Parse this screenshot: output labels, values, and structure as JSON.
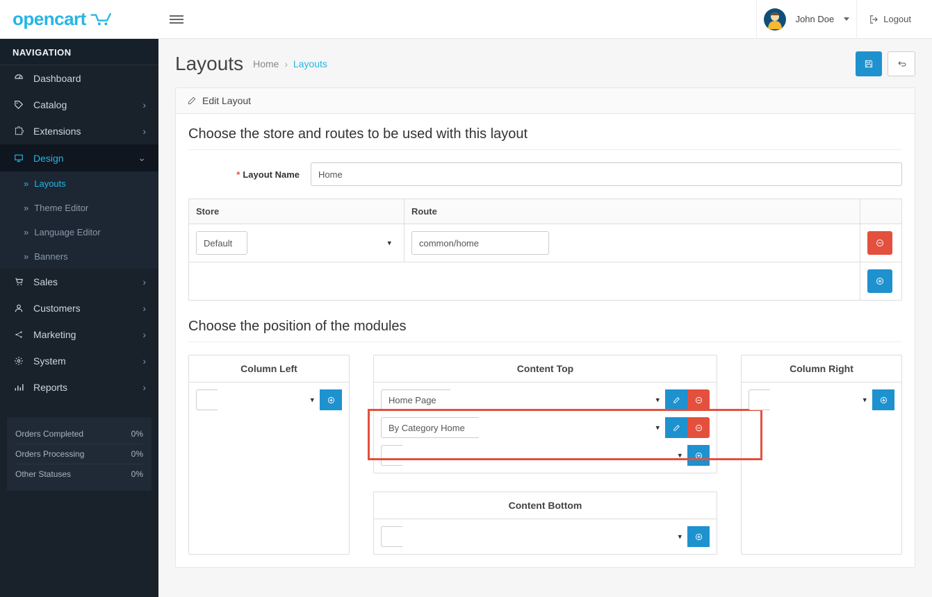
{
  "brand": "opencart",
  "header": {
    "user_name": "John Doe",
    "logout_label": "Logout"
  },
  "sidebar": {
    "nav_heading": "NAVIGATION",
    "items": [
      {
        "label": "Dashboard"
      },
      {
        "label": "Catalog"
      },
      {
        "label": "Extensions"
      },
      {
        "label": "Design"
      },
      {
        "label": "Sales"
      },
      {
        "label": "Customers"
      },
      {
        "label": "Marketing"
      },
      {
        "label": "System"
      },
      {
        "label": "Reports"
      }
    ],
    "design_sub": [
      {
        "label": "Layouts"
      },
      {
        "label": "Theme Editor"
      },
      {
        "label": "Language Editor"
      },
      {
        "label": "Banners"
      }
    ],
    "stats": [
      {
        "label": "Orders Completed",
        "value": "0%"
      },
      {
        "label": "Orders Processing",
        "value": "0%"
      },
      {
        "label": "Other Statuses",
        "value": "0%"
      }
    ]
  },
  "page": {
    "title": "Layouts",
    "breadcrumb_home": "Home",
    "breadcrumb_current": "Layouts",
    "panel_heading": "Edit Layout",
    "section1_title": "Choose the store and routes to be used with this layout",
    "section2_title": "Choose the position of the modules",
    "layout_name_label": "Layout Name",
    "layout_name_value": "Home",
    "routes": {
      "col_store": "Store",
      "col_route": "Route",
      "store_value": "Default",
      "route_value": "common/home"
    },
    "positions": {
      "column_left": "Column Left",
      "content_top": "Content Top",
      "column_right": "Column Right",
      "content_bottom": "Content Bottom",
      "top_modules": [
        {
          "label": "Home Page"
        },
        {
          "label": "By Category Home"
        }
      ]
    }
  }
}
